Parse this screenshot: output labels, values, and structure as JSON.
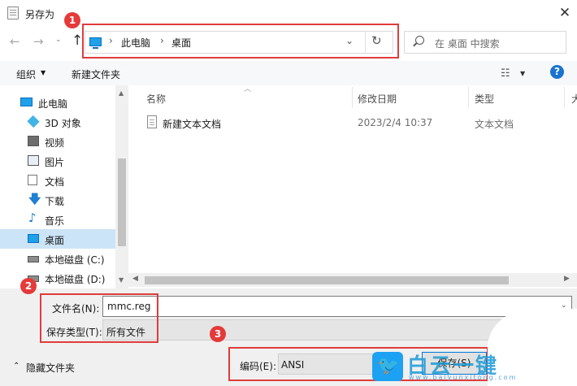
{
  "window": {
    "title": "另存为",
    "close_glyph": "✕"
  },
  "nav": {
    "back": "←",
    "forward": "→",
    "history": "⌄",
    "up": "↑",
    "crumb_sep": "›",
    "refresh": "↻",
    "dropdown": "⌄"
  },
  "address": {
    "crumbs": [
      "此电脑",
      "桌面"
    ]
  },
  "search": {
    "placeholder": "在 桌面 中搜索"
  },
  "toolbar": {
    "organize": "组织",
    "organize_arrow": "▼",
    "new_folder": "新建文件夹",
    "view_glyph": "☷",
    "view_dd": "▼",
    "help": "?"
  },
  "sidebar": {
    "items": [
      {
        "label": "此电脑",
        "icon": "computer-icon"
      },
      {
        "label": "3D 对象",
        "icon": "cube-3d-icon"
      },
      {
        "label": "视频",
        "icon": "video-icon"
      },
      {
        "label": "图片",
        "icon": "picture-icon"
      },
      {
        "label": "文档",
        "icon": "document-icon"
      },
      {
        "label": "下载",
        "icon": "download-icon"
      },
      {
        "label": "音乐",
        "icon": "music-icon"
      },
      {
        "label": "桌面",
        "icon": "desktop-icon",
        "selected": true
      },
      {
        "label": "本地磁盘 (C:)",
        "icon": "disk-icon"
      },
      {
        "label": "本地磁盘 (D:)",
        "icon": "disk-icon"
      }
    ]
  },
  "file_list": {
    "columns": [
      "名称",
      "修改日期",
      "类型",
      "大"
    ],
    "sort_arrow": "︿",
    "rows": [
      {
        "name": "新建文本文档",
        "date": "2023/2/4 10:37",
        "type": "文本文档"
      }
    ]
  },
  "scroll": {
    "up": "▲",
    "down": "▼",
    "left": "◀",
    "right": "▶"
  },
  "form": {
    "filename_label": "文件名(N):",
    "filename_value": "mmc.reg",
    "filetype_label": "保存类型(T):",
    "filetype_value": "所有文件",
    "dropdown": "⌄",
    "hide_folders_arrow": "⌃",
    "hide_folders": "隐藏文件夹",
    "encoding_label": "编码(E):",
    "encoding_value": "ANSI",
    "save": "保存(S)",
    "cancel": ""
  },
  "annotations": {
    "markers": [
      "1",
      "2",
      "3"
    ],
    "color": "#e03c3c"
  },
  "watermark": {
    "text": "白云一键",
    "url": "www.baiyunxitong.com",
    "bird": "🐦"
  }
}
